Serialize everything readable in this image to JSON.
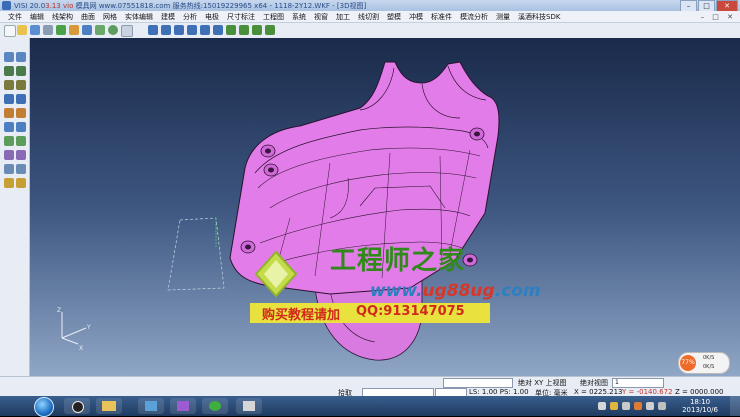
{
  "window": {
    "title_prefix": "VISI 20.0",
    "title_mid": "3.13 vio",
    "title_rest": "模具网 www.07551818.com 服务热线:15019229965 x64 - 1118-2Y12.WKF - [3D视图]"
  },
  "menu": [
    "文件",
    "编辑",
    "线架构",
    "曲面",
    "网格",
    "实体编辑",
    "建模",
    "分析",
    "电极",
    "尺寸标注",
    "工程图",
    "系统",
    "视窗",
    "加工",
    "线切割",
    "塑模",
    "冲模",
    "标准件",
    "模流分析",
    "测量",
    "溪酒科技SDK"
  ],
  "status": {
    "select_label": "拾取",
    "absolute_view_label": "绝对 XY 上视图",
    "view_label": "绝对视图",
    "view_value": "1",
    "ls_label": "LS: 1.00 PS: 1.00",
    "unit_label": "单位: 毫米",
    "x_label": "X = 0225.213",
    "y_label": "Y = -0140.672",
    "z_label": "Z = 0000.000"
  },
  "badge": {
    "percent": "77%",
    "up": "0K/S",
    "down": "0K/S"
  },
  "watermark": {
    "title": "工程师之家",
    "url_a": "www.",
    "url_mid": "ug88ug",
    "url_b": ".com",
    "buy": "购买教程请加",
    "qq": "QQ:913147075"
  },
  "clock": {
    "time": "18:10",
    "date": "2013/10/6"
  },
  "colors": {
    "part": "#e27ce8",
    "part_edge": "#2b1230",
    "titlebar": "#b7cbe8",
    "watermark_green": "#2f8a1a"
  }
}
